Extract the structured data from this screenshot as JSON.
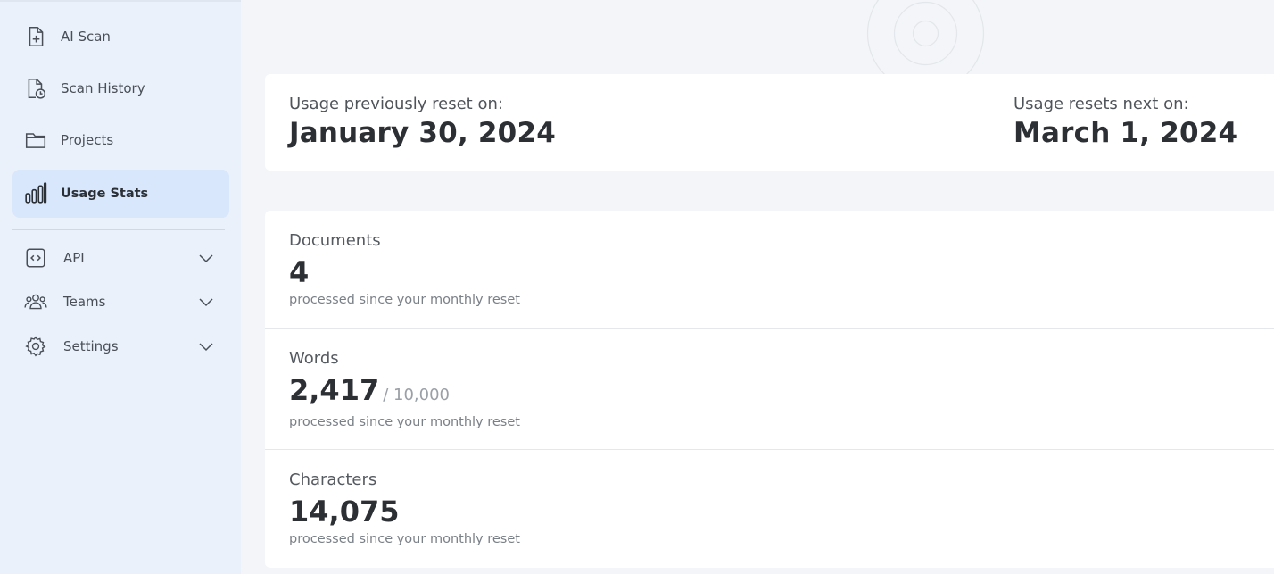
{
  "sidebar": {
    "items": [
      {
        "label": "AI Scan",
        "icon": "file-plus-icon"
      },
      {
        "label": "Scan History",
        "icon": "file-clock-icon"
      },
      {
        "label": "Projects",
        "icon": "folder-icon"
      },
      {
        "label": "Usage Stats",
        "icon": "bar-chart-icon",
        "active": true
      }
    ],
    "groups": [
      {
        "label": "API",
        "icon": "code-icon"
      },
      {
        "label": "Teams",
        "icon": "users-icon"
      },
      {
        "label": "Settings",
        "icon": "gear-icon"
      }
    ]
  },
  "usage_reset": {
    "previous_caption": "Usage previously reset on:",
    "previous_date": "January 30, 2024",
    "next_caption": "Usage resets next on:",
    "next_date": "March 1, 2024"
  },
  "stats": {
    "documents": {
      "label": "Documents",
      "value": "4",
      "note": "processed since your monthly reset"
    },
    "words": {
      "label": "Words",
      "value": "2,417",
      "limit": "/ 10,000",
      "note": "processed since your monthly reset"
    },
    "characters": {
      "label": "Characters",
      "value": "14,075",
      "note": "processed since your monthly reset"
    }
  },
  "colors": {
    "sidebar_bg": "#eaf1fb",
    "active_item_bg": "#d8e7fb",
    "page_bg": "#f3f5f8"
  }
}
